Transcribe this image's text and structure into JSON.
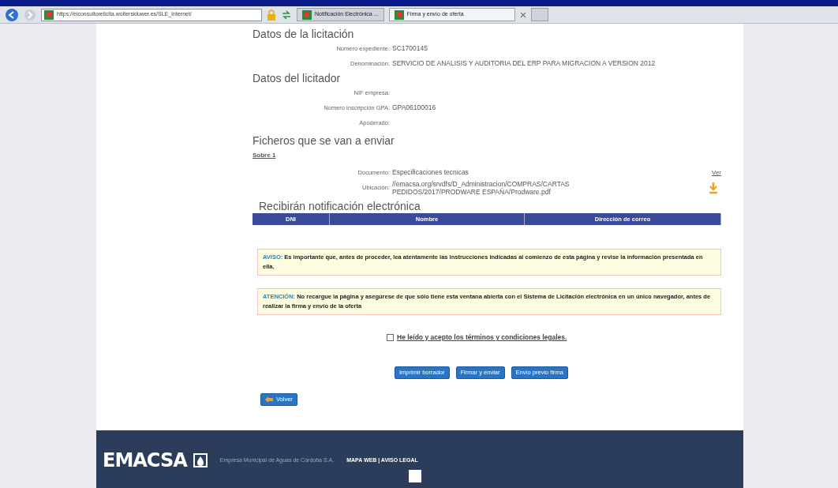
{
  "browser": {
    "address": "https://elconsultorelicita.wolterskluwer.es/SLE_Internet/",
    "tabs": [
      {
        "label": "Notificación Electrónica ...",
        "selected": false
      },
      {
        "label": "Firma y envío de oferta",
        "selected": true
      }
    ]
  },
  "sections": [
    {
      "title": "Datos de la licitación",
      "fields": [
        {
          "label": "Número expediente:",
          "value": "SC1700145"
        },
        {
          "label": "Denominación:",
          "value": "SERVICIO DE ANALISIS Y AUDITORIA DEL ERP PARA MIGRACION A VERSION 2012"
        }
      ]
    },
    {
      "title": "Datos del licitador",
      "fields": [
        {
          "label": "NIF empresa:"
        },
        {
          "label": "Número inscripción GPA:",
          "value": "GPA06100016"
        },
        {
          "label": "Apoderado:"
        }
      ]
    }
  ],
  "files": {
    "title": "Ficheros que se van a enviar",
    "envelope": "Sobre 1",
    "document_label": "Documento:",
    "document": "Especificaciones tecnicas",
    "view_link": "Ver",
    "location_label": "Ubicación:",
    "location": "//emacsa.org/srvdfs/D_Administracion/COMPRAS/CARTAS PEDIDOS/2017/PRODWARE ESPAÑA/Prodware.pdf"
  },
  "notification": {
    "title": "Recibirán notificación electrónica",
    "columns": [
      "DNI",
      "Nombre",
      "Dirección de correo"
    ]
  },
  "notices": [
    {
      "label": "AVISO:",
      "text": "Es importante que, antes de proceder, lea atentamente las instrucciones indicadas al comienzo de esta página y revise la información presentada en ella."
    },
    {
      "label": "ATENCIÓN:",
      "text": "No recargue la página y asegúrese de que sólo tiene esta ventana abierta con el Sistema de Licitación electrónica en un único navegador, antes de realizar la firma y envío de la oferta"
    }
  ],
  "terms": {
    "label": "He leído y acepto los términos y condiciones legales.",
    "checked": false
  },
  "buttons": [
    "Imprimir borrador",
    "Firmar y enviar",
    "Envío previo firma"
  ],
  "back_button": "Volver",
  "footer": {
    "logo": "EMACSA",
    "company": "Empresa Municipal de Aguas de Córdoba S.A.",
    "links": "MAPA WEB | AVISO LEGAL"
  }
}
